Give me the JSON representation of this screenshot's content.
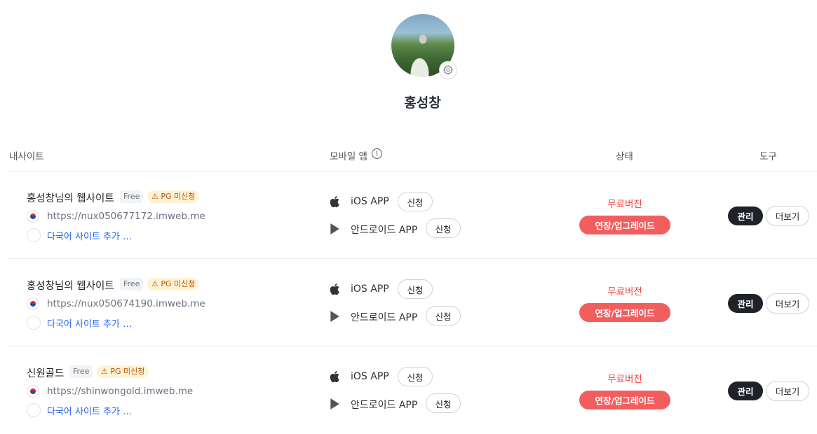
{
  "profile": {
    "name": "홍성창",
    "avatar_icon": "profile-photo",
    "settings_icon": "gear-icon"
  },
  "table": {
    "headers": {
      "site": "내사이트",
      "mobile_app": "모바일 앱",
      "status": "상태",
      "tools": "도구"
    },
    "info_icon": "i"
  },
  "sites": [
    {
      "name": "홍성창님의 웹사이트",
      "plan_badge": "Free",
      "pg_badge": "PG 미신청",
      "url": "https://nux050677172.imweb.me",
      "add_language": "다국어 사이트 추가 …",
      "ios_label": "iOS APP",
      "ios_button": "신청",
      "android_label": "안드로이드 APP",
      "android_button": "신청",
      "status": "무료버전",
      "upgrade_button": "연장/업그레이드",
      "manage_button": "관리",
      "more_button": "더보기"
    },
    {
      "name": "홍성창님의 웹사이트",
      "plan_badge": "Free",
      "pg_badge": "PG 미신청",
      "url": "https://nux050674190.imweb.me",
      "add_language": "다국어 사이트 추가 …",
      "ios_label": "iOS APP",
      "ios_button": "신청",
      "android_label": "안드로이드 APP",
      "android_button": "신청",
      "status": "무료버전",
      "upgrade_button": "연장/업그레이드",
      "manage_button": "관리",
      "more_button": "더보기"
    },
    {
      "name": "신원골드",
      "plan_badge": "Free",
      "pg_badge": "PG 미신청",
      "url": "https://shinwongold.imweb.me",
      "add_language": "다국어 사이트 추가 …",
      "ios_label": "iOS APP",
      "ios_button": "신청",
      "android_label": "안드로이드 APP",
      "android_button": "신청",
      "status": "무료버전",
      "upgrade_button": "연장/업그레이드",
      "manage_button": "관리",
      "more_button": "더보기"
    }
  ],
  "colors": {
    "status_red": "#ef4444",
    "upgrade_bg": "#f25e5e",
    "manage_bg": "#1f2329",
    "link_blue": "#2563eb",
    "pg_badge_bg": "#fff3d6"
  }
}
